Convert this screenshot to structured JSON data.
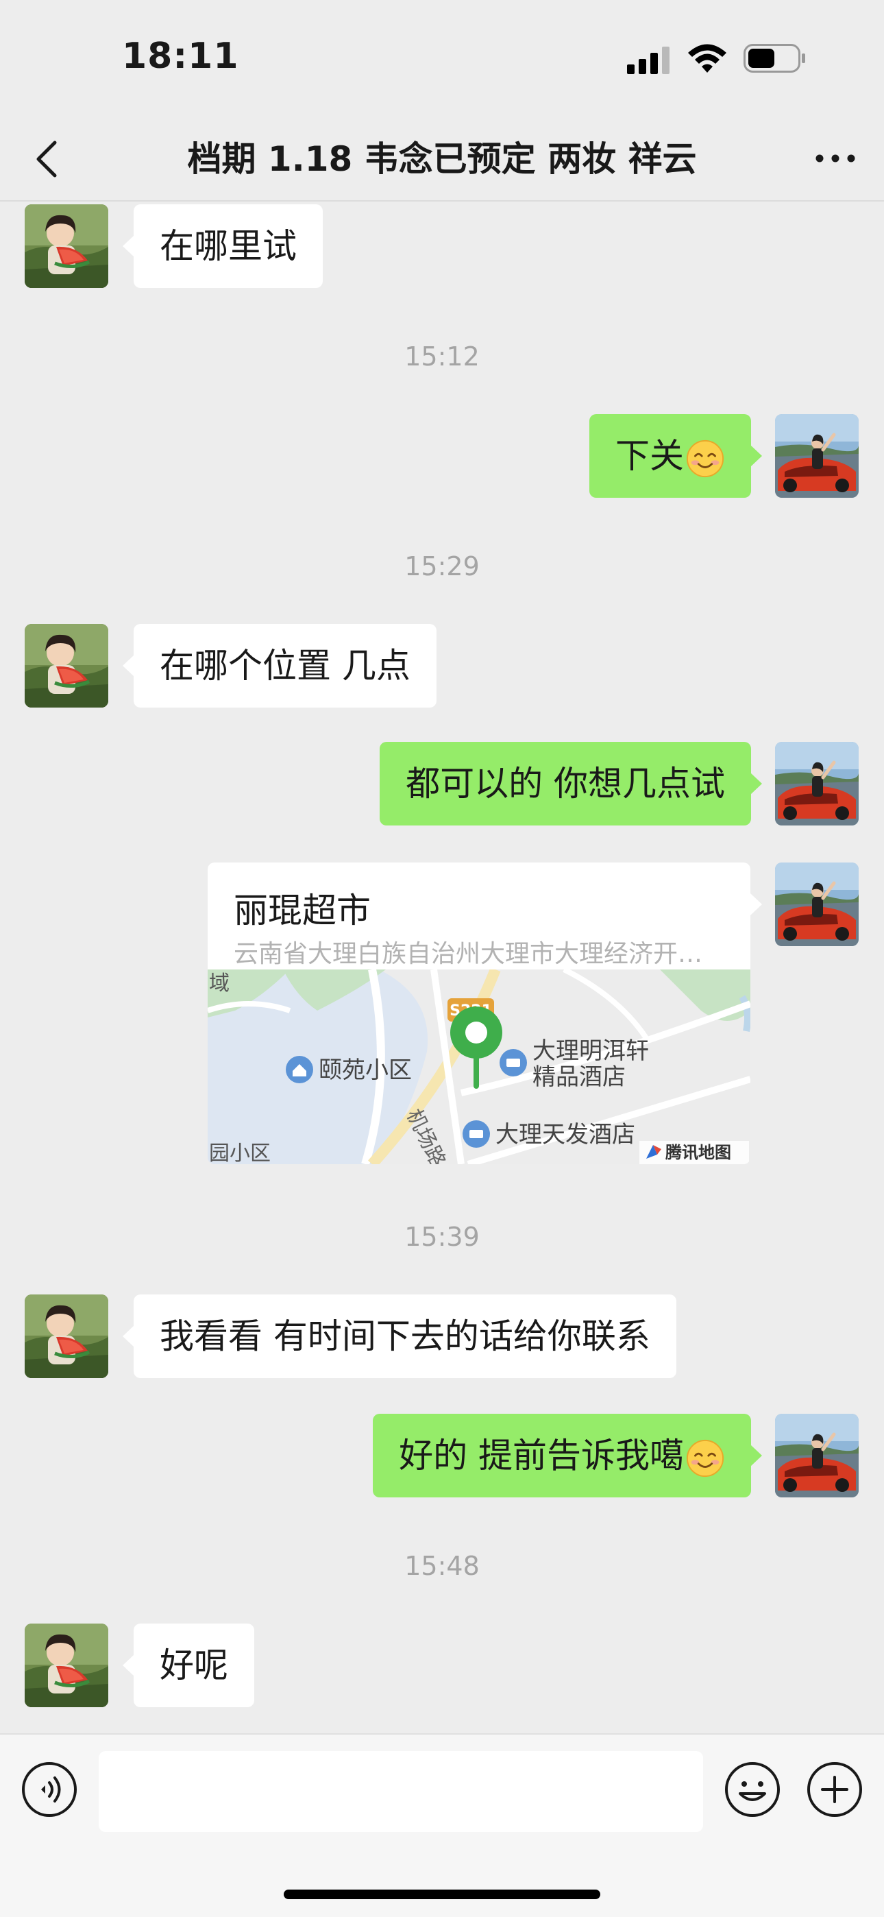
{
  "status_bar": {
    "time": "18:11",
    "icons": [
      "signal-icon",
      "wifi-icon",
      "battery-icon"
    ]
  },
  "nav": {
    "title": "档期 1.18 韦念已预定 两妆 祥云",
    "back_icon": "chevron-left-icon",
    "more_icon": "ellipsis-icon"
  },
  "colors": {
    "background": "#ededed",
    "self_bubble": "#95ec69",
    "other_bubble": "#ffffff",
    "timestamp": "#a4a4a4"
  },
  "messages": [
    {
      "from": "other",
      "type": "text",
      "text": "在哪里试"
    },
    {
      "type": "timestamp",
      "text": "15:12"
    },
    {
      "from": "me",
      "type": "text",
      "text": "下关",
      "emoji": "smile-emoji"
    },
    {
      "type": "timestamp",
      "text": "15:29"
    },
    {
      "from": "other",
      "type": "text",
      "text": "在哪个位置 几点"
    },
    {
      "from": "me",
      "type": "text",
      "text": "都可以的 你想几点试"
    },
    {
      "from": "me",
      "type": "location",
      "name": "丽琨超市",
      "address": "云南省大理白族自治州大理市大理经济开…",
      "map_labels": {
        "area_top": "域",
        "residence": "颐苑小区",
        "hotel1_line1": "大理明洱轩",
        "hotel1_line2": "精品酒店",
        "hotel2": "大理天发酒店",
        "area_bottom": "园小区",
        "road": "机场路",
        "road_sign": "S221",
        "provider": "腾讯地图"
      }
    },
    {
      "type": "timestamp",
      "text": "15:39"
    },
    {
      "from": "other",
      "type": "text",
      "text": "我看看 有时间下去的话给你联系"
    },
    {
      "from": "me",
      "type": "text",
      "text": "好的 提前告诉我噶",
      "emoji": "smile-emoji"
    },
    {
      "type": "timestamp",
      "text": "15:48"
    },
    {
      "from": "other",
      "type": "text",
      "text": "好呢"
    }
  ],
  "input_bar": {
    "voice_icon": "voice-icon",
    "placeholder": "",
    "emoji_icon": "emoji-icon",
    "plus_icon": "plus-icon"
  }
}
